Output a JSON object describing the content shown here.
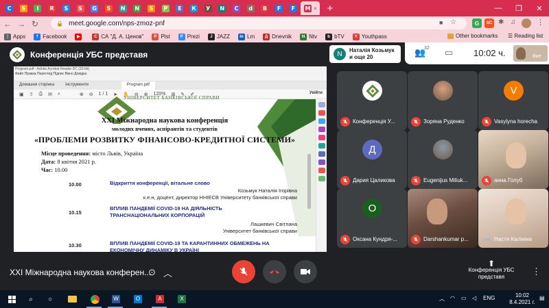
{
  "browser": {
    "tab_favicon_letters": [
      "C",
      "S",
      "I",
      "R",
      "S",
      "S",
      "G",
      "S",
      "N",
      "N",
      "S",
      "P",
      "E",
      "К",
      "У",
      "N",
      "C",
      "d",
      "B",
      "F",
      "F",
      "M"
    ],
    "active_tab_close": "×",
    "new_tab": "+",
    "url": "meet.google.com/nps-zmoz-pnf",
    "bookmarks": [
      {
        "label": "Apps",
        "icon": "apps-icon",
        "color": "#5f6368",
        "letter": "⋮"
      },
      {
        "label": "Facebook",
        "icon": "facebook-icon",
        "color": "#1877f2",
        "letter": "f"
      },
      {
        "label": "",
        "icon": "youtube-icon",
        "color": "#ff0000",
        "letter": "▶"
      },
      {
        "label": "СА \"Д. А. Ценов\"",
        "icon": "sa-icon",
        "color": "#c0392b",
        "letter": "С"
      },
      {
        "label": "Plst",
        "icon": "plst-icon",
        "color": "#e74c3c",
        "letter": "P"
      },
      {
        "label": "Prezi",
        "icon": "prezi-icon",
        "color": "#318bff",
        "letter": "P"
      },
      {
        "label": "JAZZ",
        "icon": "jazz-icon",
        "color": "#222",
        "letter": "J"
      },
      {
        "label": "Lm",
        "icon": "lm-icon",
        "color": "#0a66c2",
        "letter": "in"
      },
      {
        "label": "Dnevnik",
        "icon": "dnevnik-icon",
        "color": "#c62828",
        "letter": "Д"
      },
      {
        "label": "Ntv",
        "icon": "ntv-icon",
        "color": "#2e7d32",
        "letter": "N"
      },
      {
        "label": "bTV",
        "icon": "btv-icon",
        "color": "#222",
        "letter": "b"
      },
      {
        "label": "Youthpass",
        "icon": "youthpass-icon",
        "color": "#e53935",
        "letter": "Y"
      }
    ],
    "other_bookmarks": "Other bookmarks",
    "reading_list": "Reading list",
    "extension_letters": [
      "G",
      "SC"
    ]
  },
  "meet": {
    "title": "Конференція УБС представя",
    "presenter_name": "Наталія Козьмук",
    "presenter_more": "и още 20",
    "presenter_initial": "N",
    "participants_count": "32",
    "time": "10:02 ч.",
    "self_label": "Вие",
    "meeting_name": "XXI Міжнародна наукова конферен...",
    "present_label": "Конференція УБС представя",
    "colors": {
      "mic_off": "#ea4335",
      "background": "#202124",
      "tile": "#3c4043"
    }
  },
  "participants": [
    {
      "name": "Конференція У...",
      "initial": "",
      "avatar_color": "#ffffff",
      "kind": "logo"
    },
    {
      "name": "Зоряна Руденко",
      "initial": "",
      "avatar_color": "#d9a07a",
      "kind": "photo"
    },
    {
      "name": "Vasylyna horecha",
      "initial": "V",
      "avatar_color": "#f57c00",
      "kind": "letter"
    },
    {
      "name": "Дария Цаликова",
      "initial": "Д",
      "avatar_color": "#5c6bc0",
      "kind": "letter"
    },
    {
      "name": "Eugenijus Miliuk...",
      "initial": "",
      "avatar_color": "#8d9aa6",
      "kind": "photo"
    },
    {
      "name": "анна Голуб",
      "initial": "",
      "avatar_color": "",
      "kind": "video"
    },
    {
      "name": "Оксана Кундря-...",
      "initial": "О",
      "avatar_color": "#1b5e20",
      "kind": "letter"
    },
    {
      "name": "Darshankumar р...",
      "initial": "",
      "avatar_color": "",
      "kind": "video"
    },
    {
      "name": "Настя Калініна",
      "initial": "",
      "avatar_color": "",
      "kind": "video"
    }
  ],
  "acrobat": {
    "window_title": "Program.pdf - Adobe Acrobat Reader DC (32-bit)",
    "menu": "Файл  Правка  Перегляд  Підпис  Вікно  Довідка",
    "tabs": [
      "Домашня сторінка",
      "Інструменти",
      "Program.pdf"
    ],
    "page_indicator": "1 / 1",
    "zoom": "120%",
    "share": "Увійти"
  },
  "document": {
    "university_caption": "УНІВЕРСИТЕТ БАНКІВСЬКОЇ СПРАВИ",
    "title_line1": "XXI Міжнародна наукова конференція",
    "title_line2": "молодих вчених, аспірантів та студентів",
    "title_line3": "«ПРОБЛЕМИ РОЗВИТКУ ФІНАНСОВО-КРЕДИТНОЇ СИСТЕМИ»",
    "place_label": "Місце проведення:",
    "place_value": " місто Львів, Україна",
    "date_label": "Дата:",
    "date_value": " 8 квітня 2021 р.",
    "time_label": "Час:",
    "time_value": " 10.00",
    "rows": [
      {
        "time": "10.00",
        "title": "Відкриття конференції, вітальне слово",
        "speaker": "Козьмук Наталія Ігорівна",
        "role": "к.е.н, доцент, директор ННІЕСВ Університету банківської справи"
      },
      {
        "time": "10.15",
        "title": "ВПЛИВ ПАНДЕМІЇ COVID-19 НА ДІЯЛЬНІСТЬ\nТРАНСНАЦІОНАЛЬНИХ КОРПОРАЦІЙ",
        "speaker": "Лашкевич Світлана",
        "role": "Університет банківської справи"
      },
      {
        "time": "10.30",
        "title": "ВПЛИВ ПАНДЕМІЇ COVID-19 ТА КАРАНТИННИХ ОБМЕЖЕНЬ НА\nЕКОНОМІЧНУ ДИНАМІКУ В УКРАЇНІ",
        "speaker": "",
        "role": ""
      }
    ]
  },
  "taskbar": {
    "lang": "ENG",
    "time": "10:02",
    "date": "8.4.2021 г."
  }
}
